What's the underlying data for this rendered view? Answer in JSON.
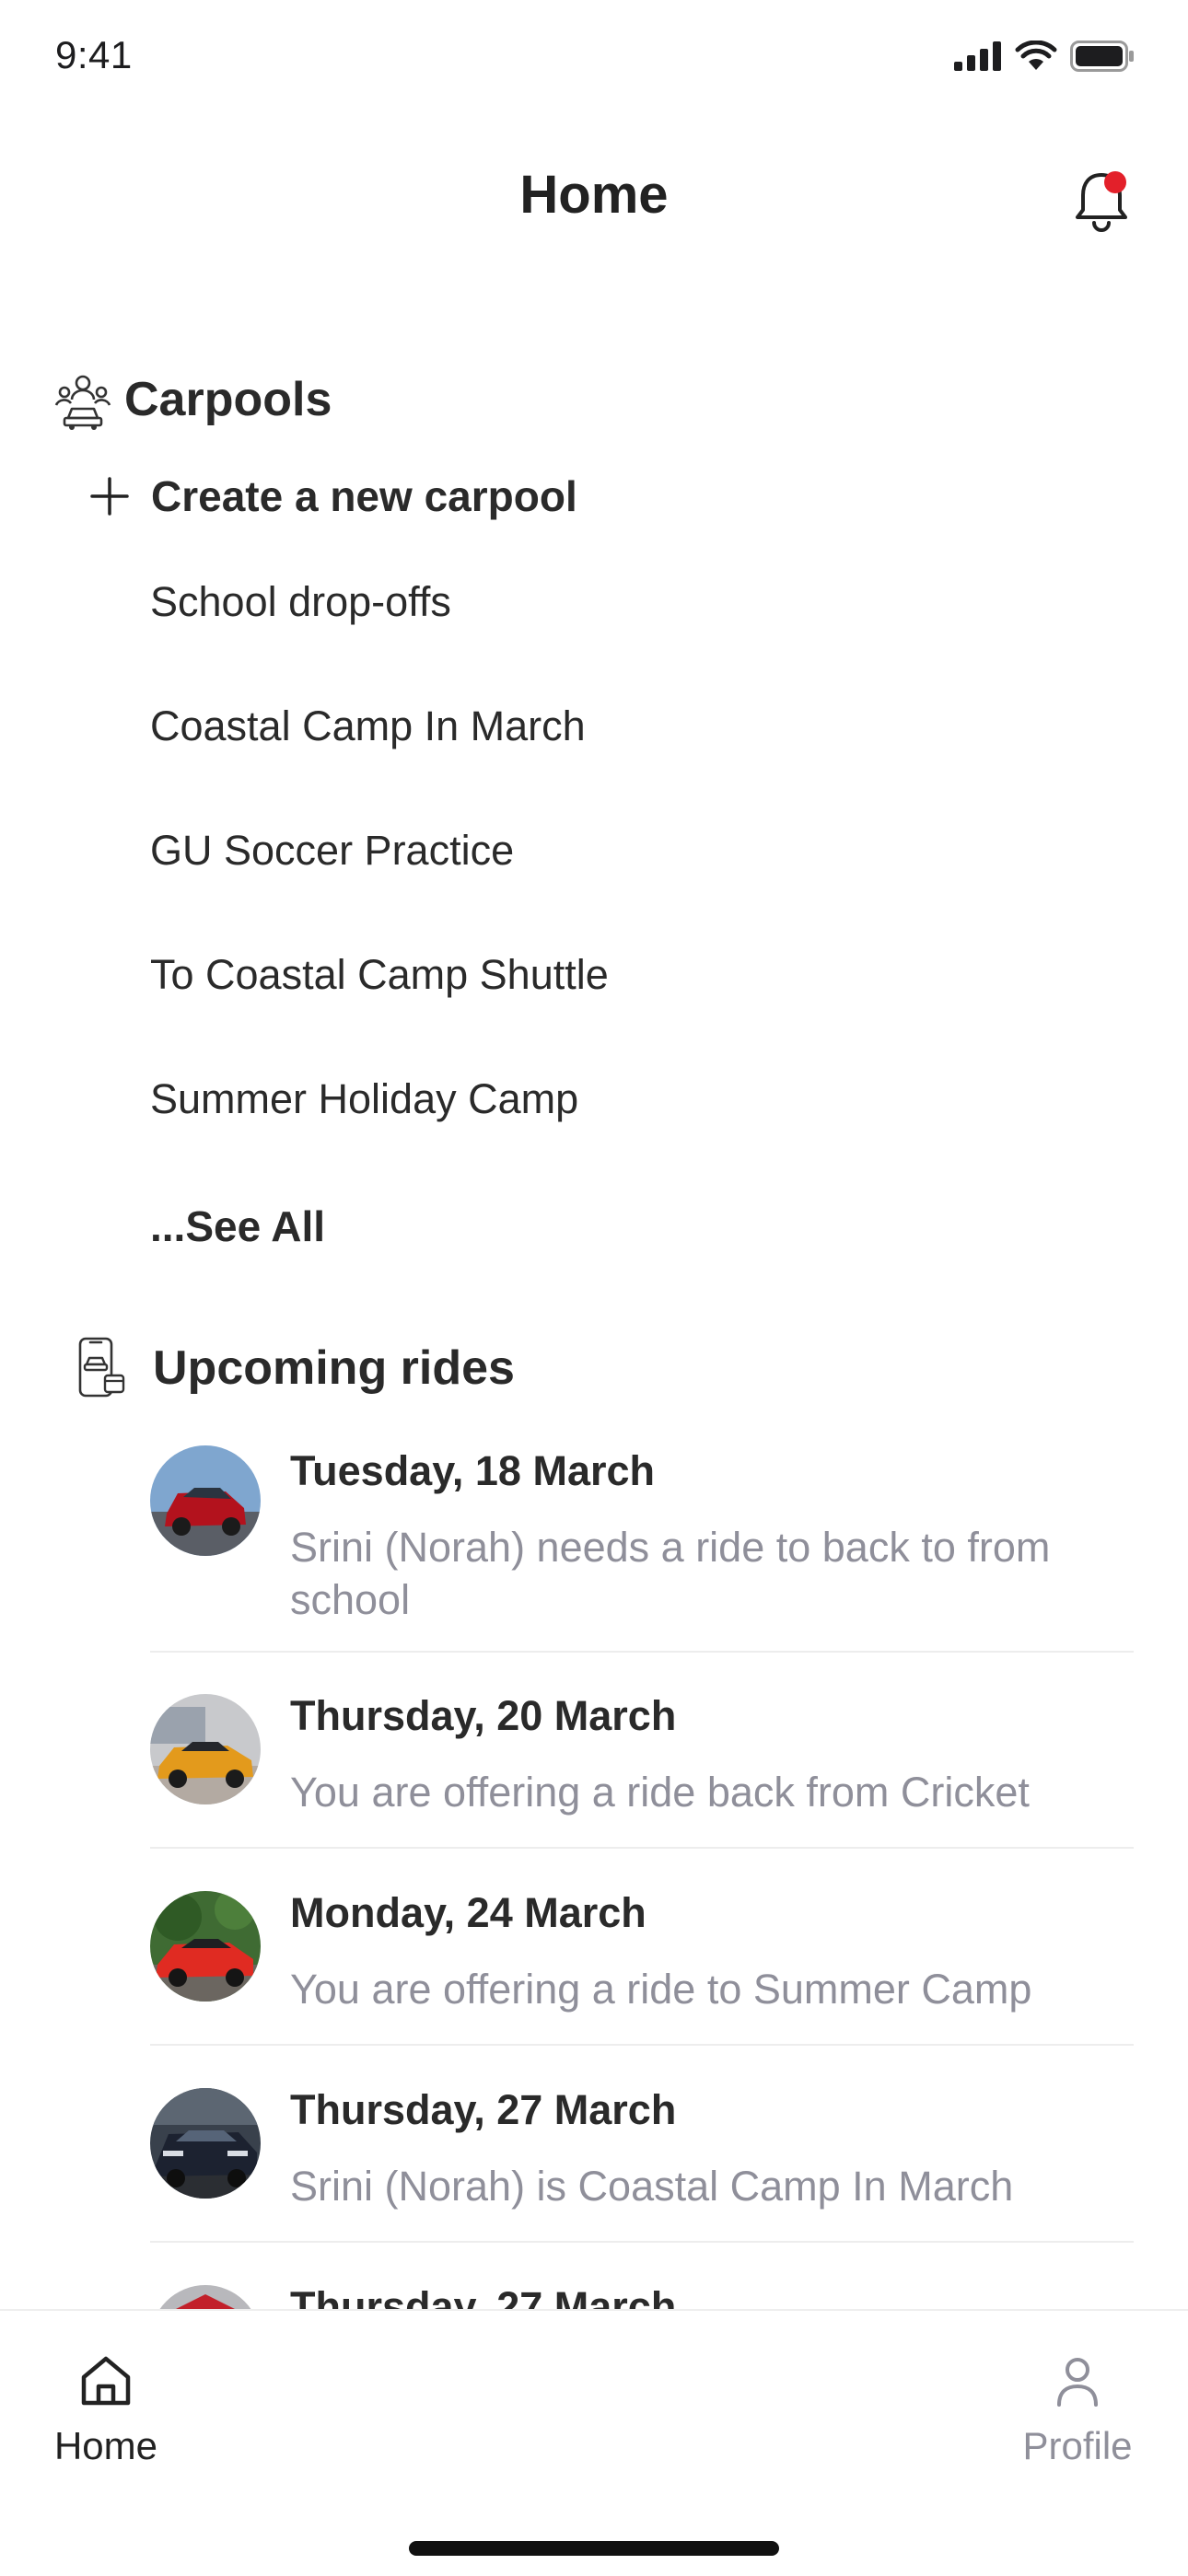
{
  "status_bar": {
    "time": "9:41"
  },
  "header": {
    "title": "Home",
    "notification_icon": "bell-icon",
    "notification_dot_color": "#e3202a"
  },
  "carpools": {
    "title": "Carpools",
    "icon": "carpool-group-icon",
    "create_label": "Create a new carpool",
    "items": [
      {
        "label": "School drop-offs"
      },
      {
        "label": "Coastal Camp In March"
      },
      {
        "label": "GU Soccer Practice"
      },
      {
        "label": "To Coastal Camp Shuttle"
      },
      {
        "label": "Summer Holiday Camp"
      }
    ],
    "see_all_label": "...See All"
  },
  "upcoming_rides": {
    "title": "Upcoming rides",
    "icon": "phone-car-calendar-icon",
    "rides": [
      {
        "date": "Tuesday, 18 March",
        "description": "Srini (Norah) needs a ride to back to from school",
        "avatar": "car-photo-red-sedan"
      },
      {
        "date": "Thursday, 20 March",
        "description": "You are offering a ride back from Cricket",
        "avatar": "car-photo-orange-sports"
      },
      {
        "date": "Monday, 24 March",
        "description": "You are offering a ride to Summer  Camp",
        "avatar": "car-photo-red-sports"
      },
      {
        "date": "Thursday, 27 March",
        "description": "Srini (Norah) is Coastal Camp In March",
        "avatar": "car-photo-dark-suv"
      },
      {
        "date": "Thursday, 27 March",
        "description": "",
        "avatar": "car-photo-partial"
      }
    ]
  },
  "bottom_nav": {
    "home_label": "Home",
    "profile_label": "Profile",
    "active_color": "#222222",
    "inactive_color": "#8f8f9a"
  }
}
